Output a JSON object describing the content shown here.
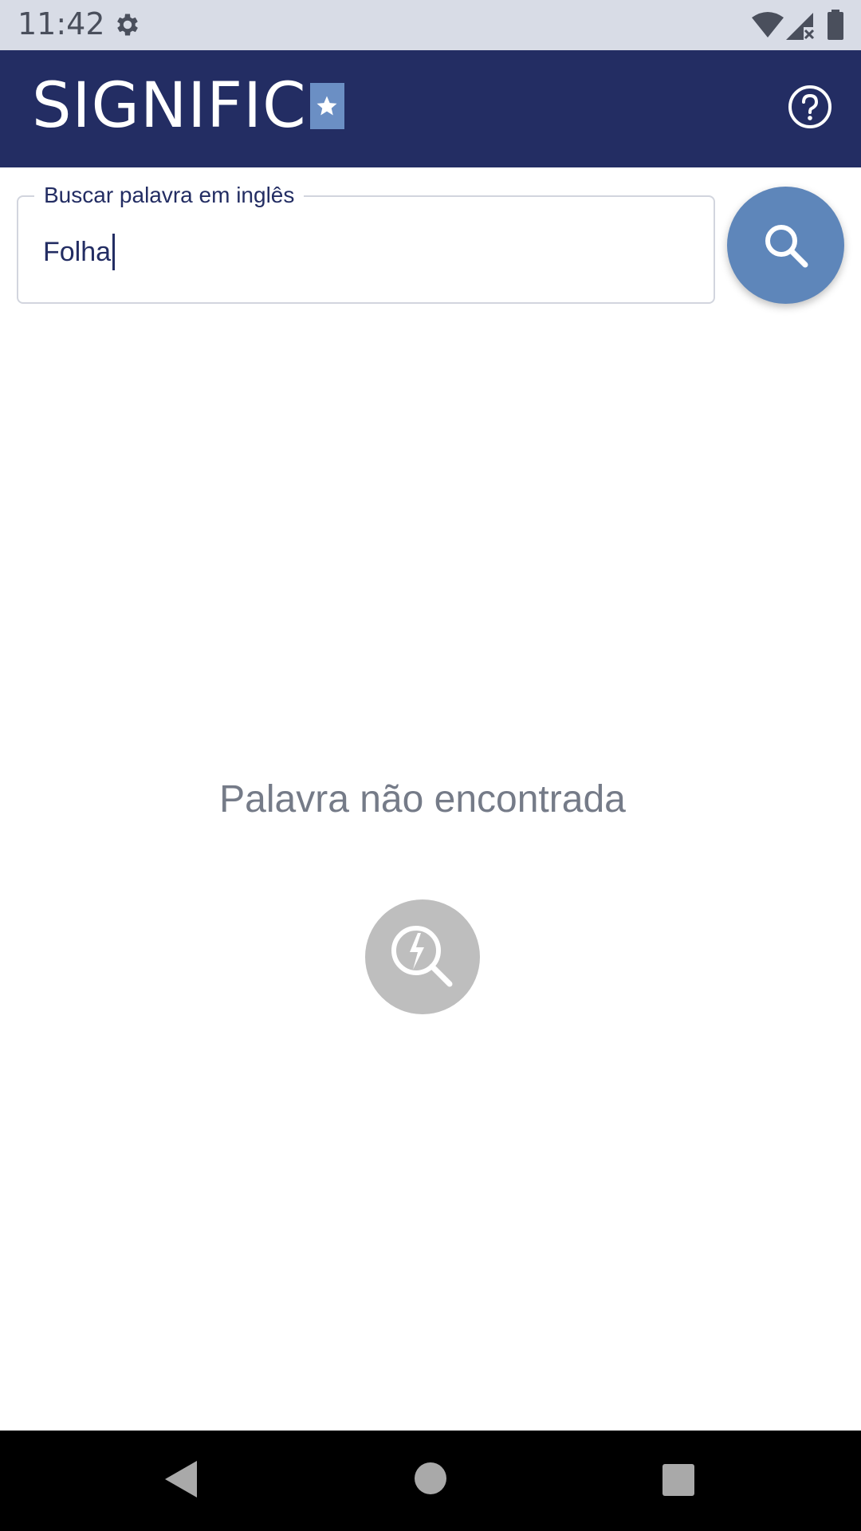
{
  "status_bar": {
    "time": "11:42",
    "icons": [
      "gear-icon",
      "wifi-icon",
      "signal-icon",
      "battery-icon"
    ]
  },
  "app_bar": {
    "logo_text": "SIGNIFIC",
    "logo_star": "★",
    "help_icon": "help-circle-icon"
  },
  "search": {
    "label": "Buscar palavra em inglês",
    "value": "Folha",
    "button_icon": "search-icon"
  },
  "empty_state": {
    "message": "Palavra não encontrada",
    "icon": "broken-search-icon"
  },
  "nav": {
    "back": "back-icon",
    "home": "home-icon",
    "recent": "recent-apps-icon"
  },
  "colors": {
    "primary": "#232d63",
    "accent": "#5e86ba",
    "status_bar": "#d8dce6",
    "empty_icon_bg": "#bebebe"
  }
}
